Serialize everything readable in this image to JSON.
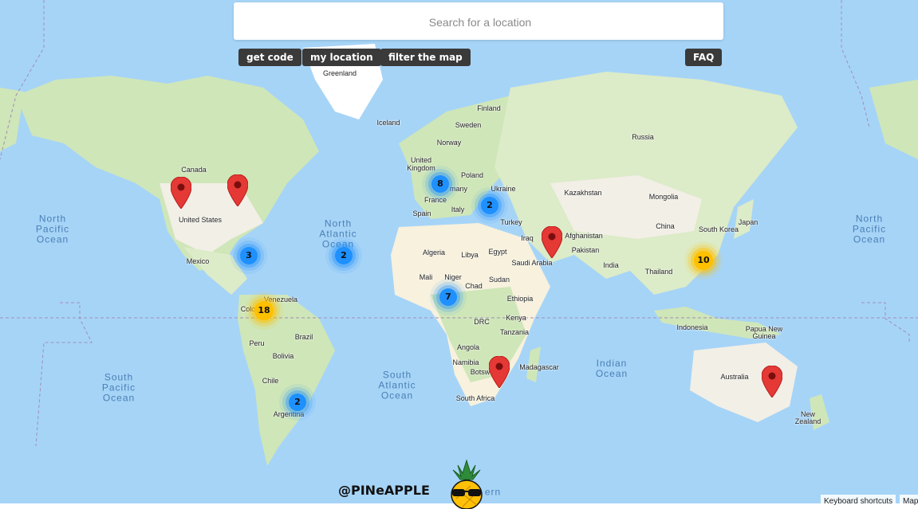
{
  "search": {
    "placeholder": "Search for a location",
    "value": ""
  },
  "buttons": {
    "get_code": "get code",
    "my_location": "my location",
    "filter": "filter the map",
    "faq": "FAQ"
  },
  "countries": {
    "greenland": "Greenland",
    "iceland": "Iceland",
    "finland": "Finland",
    "sweden": "Sweden",
    "norway": "Norway",
    "russia": "Russia",
    "uk1": "United",
    "uk2": "Kingdom",
    "poland": "Poland",
    "germany": "many",
    "ukraine": "Ukraine",
    "france": "France",
    "spain": "Spain",
    "italy": "Italy",
    "turkey": "Turkey",
    "kazakhstan": "Kazakhstan",
    "mongolia": "Mongolia",
    "china": "China",
    "japan": "Japan",
    "south_korea": "South Korea",
    "iraq": "Iraq",
    "afghanistan": "Afghanistan",
    "pakistan": "Pakistan",
    "india": "India",
    "saudi": "Saudi Arabia",
    "thailand": "Thailand",
    "algeria": "Algeria",
    "libya": "Libya",
    "egypt": "Egypt",
    "mali": "Mali",
    "niger": "Niger",
    "chad": "Chad",
    "sudan": "Sudan",
    "ethiopia": "Ethiopia",
    "kenya": "Kenya",
    "drc": "DRC",
    "tanzania": "Tanzania",
    "angola": "Angola",
    "namibia": "Namibia",
    "botswana": "Botsw",
    "madagascar": "Madagascar",
    "south_africa": "South Africa",
    "indonesia": "Indonesia",
    "png1": "Papua New",
    "png2": "Guinea",
    "australia": "Australia",
    "nz1": "New",
    "nz2": "Zealand",
    "canada": "Canada",
    "usa": "United States",
    "mexico": "Mexico",
    "venezuela": "Venezuela",
    "colombia": "Colo",
    "brazil": "Brazil",
    "peru": "Peru",
    "bolivia": "Bolivia",
    "chile": "Chile",
    "argentina": "Argentina"
  },
  "oceans": {
    "north_pacific_w": "North Pacific Ocean",
    "north_pacific_e": "North Pacific Ocean",
    "north_atlantic": "North Atlantic Ocean",
    "south_pacific": "South Pacific Ocean",
    "south_atlantic": "South Atlantic Ocean",
    "indian": "Indian Ocean",
    "southern": "ern"
  },
  "clusters": [
    {
      "label": "8",
      "color": "blue"
    },
    {
      "label": "2",
      "color": "blue"
    },
    {
      "label": "3",
      "color": "blue"
    },
    {
      "label": "2",
      "color": "blue"
    },
    {
      "label": "7",
      "color": "blue"
    },
    {
      "label": "2",
      "color": "blue"
    },
    {
      "label": "18",
      "color": "yellow"
    },
    {
      "label": "10",
      "color": "yellow"
    }
  ],
  "brand": "@PINeAPPLE",
  "attribution": {
    "shortcuts": "Keyboard shortcuts",
    "map": "Map"
  },
  "colors": {
    "water": "#a6d4f7",
    "land": "#f2efe6",
    "vegetation": "#cfe6b8",
    "desert": "#f7f1dd",
    "pin": "#e53935",
    "cluster_blue": "#1e90ff",
    "cluster_yellow": "#ffc000"
  }
}
